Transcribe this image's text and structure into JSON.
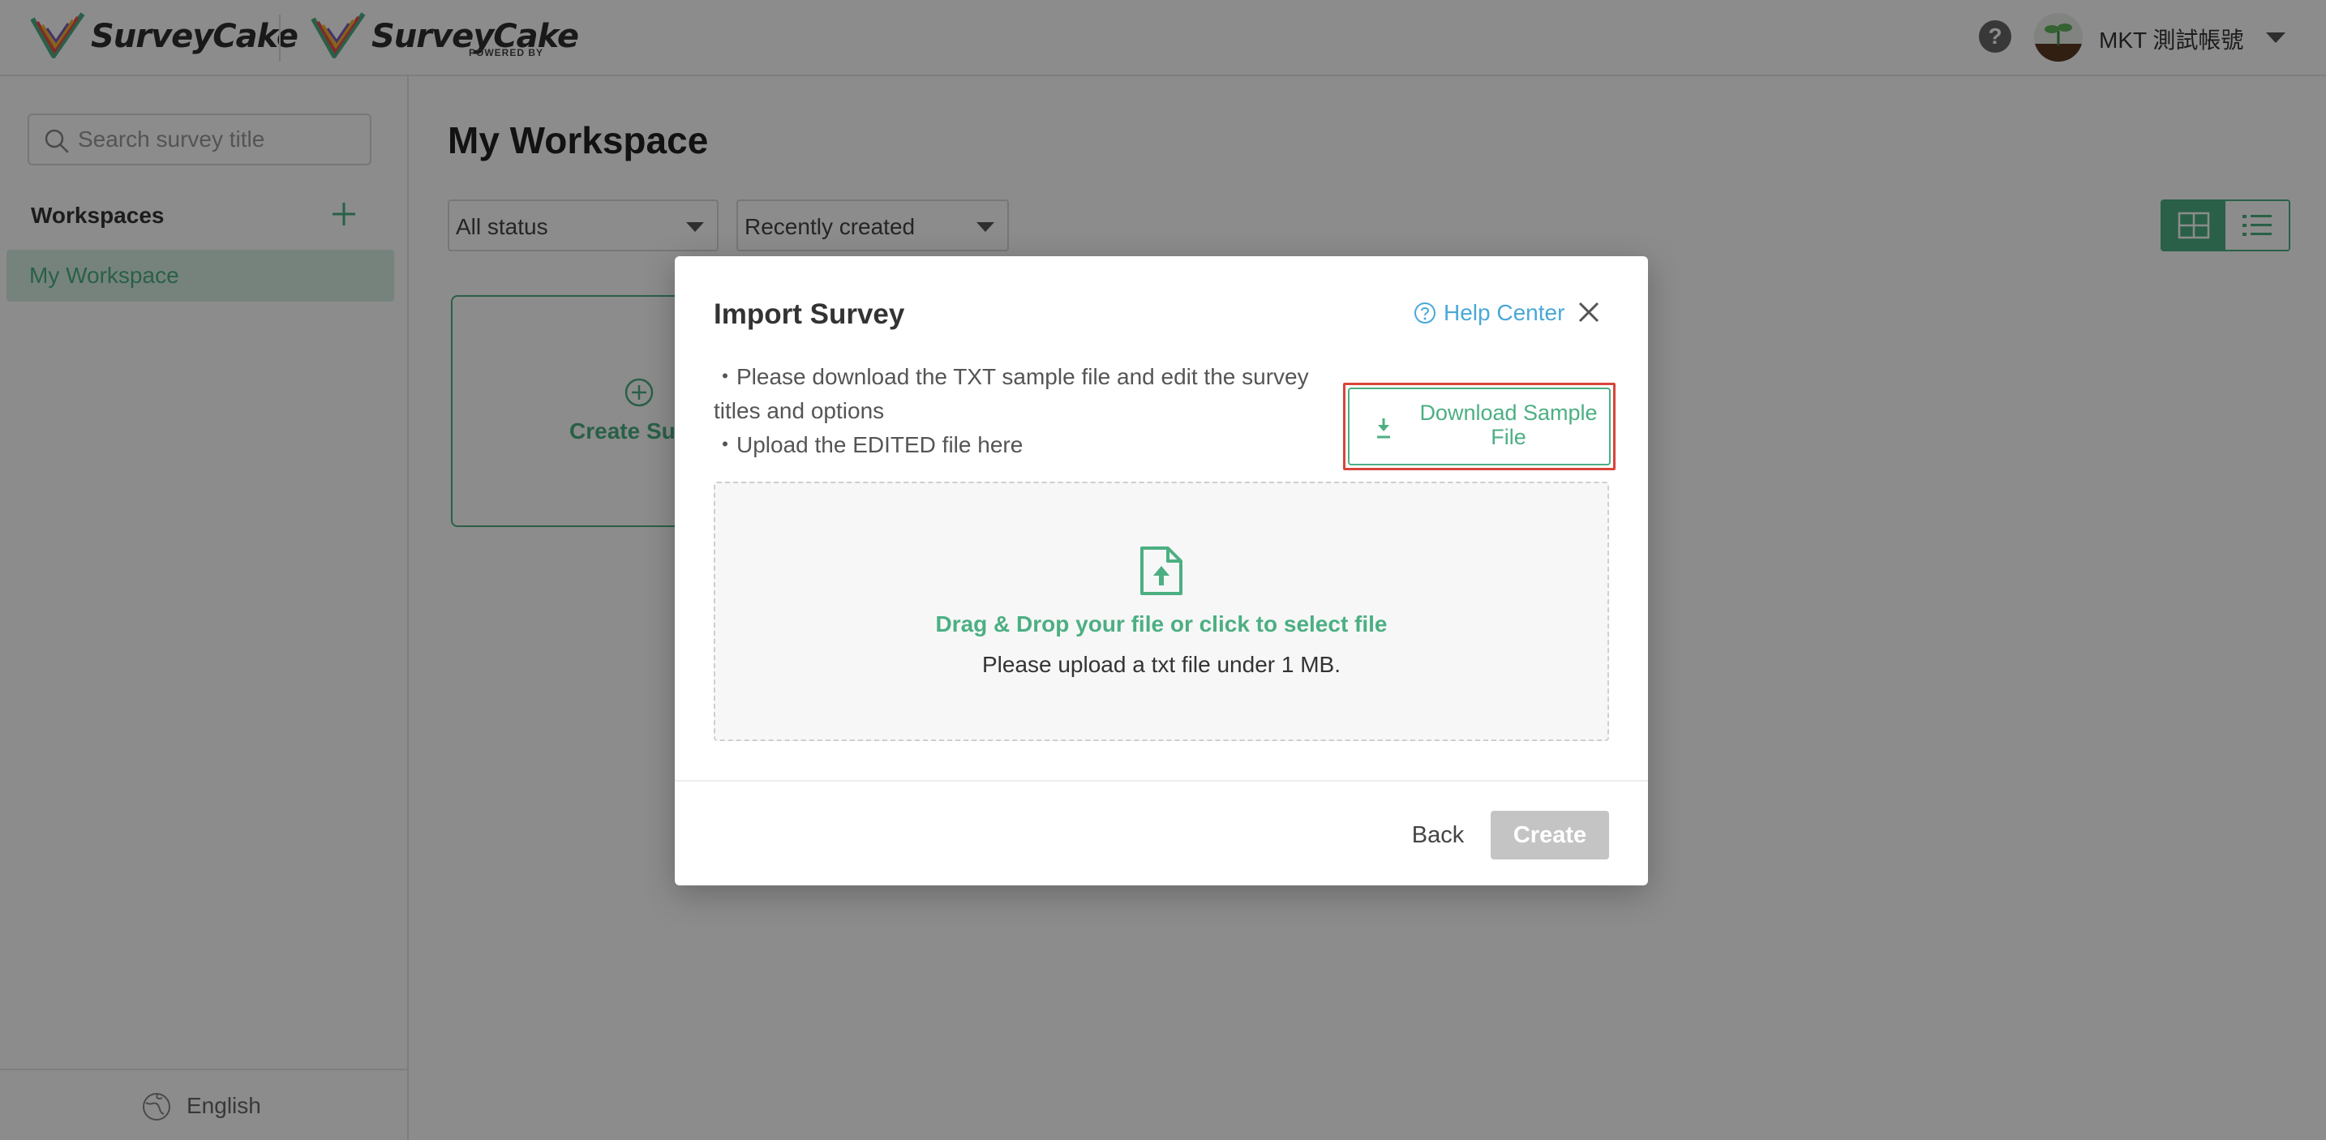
{
  "header": {
    "brand_name": "SurveyCake",
    "brand_name_secondary": "SurveyCake",
    "brand_subtext": "POWERED BY",
    "help_icon": "question-circle-icon",
    "help_glyph": "?",
    "user": {
      "name": "MKT 測試帳號",
      "avatar_icon": "sprout-avatar-icon"
    }
  },
  "sidebar": {
    "search": {
      "placeholder": "Search survey title",
      "value": ""
    },
    "workspaces_title": "Workspaces",
    "items": [
      {
        "label": "My Workspace",
        "active": true
      }
    ],
    "language": "English"
  },
  "main": {
    "title": "My Workspace",
    "filters": {
      "status": "All status",
      "sort": "Recently created"
    },
    "view_mode": "grid",
    "create_card_label": "Create Sur"
  },
  "modal": {
    "title": "Import Survey",
    "help_link": "Help Center",
    "instructions": [
      "・Please download the TXT sample file and edit the survey titles and options",
      "・Upload the EDITED file here"
    ],
    "download_button": "Download Sample File",
    "dropzone": {
      "title": "Drag & Drop your file or click to select file",
      "hint": "Please upload a txt file under 1 MB."
    },
    "back_button": "Back",
    "create_button": "Create"
  },
  "colors": {
    "accent": "#4caf82",
    "link": "#4aa8d8",
    "highlight": "#d9443a",
    "disabled": "#c4c4c4"
  }
}
